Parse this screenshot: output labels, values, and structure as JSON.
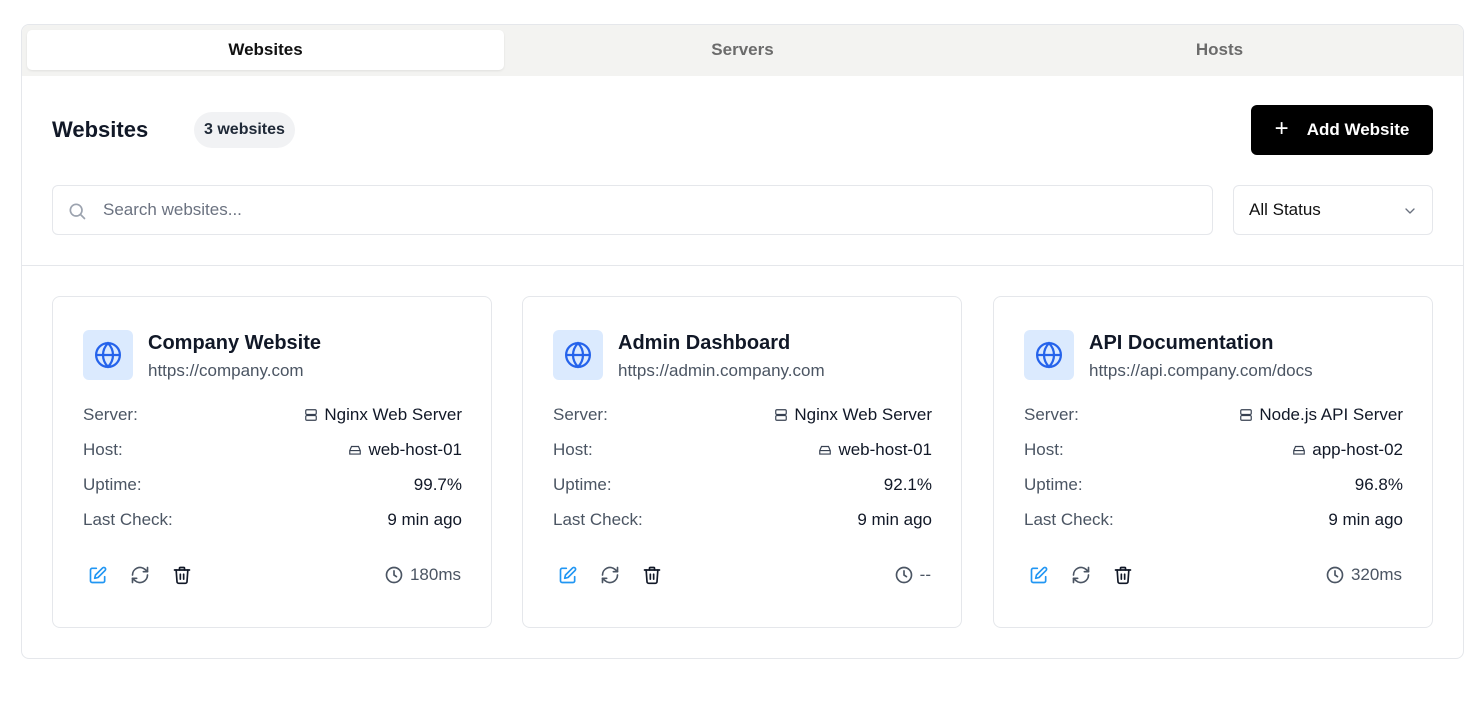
{
  "tabs": [
    {
      "label": "Websites",
      "active": true
    },
    {
      "label": "Servers",
      "active": false
    },
    {
      "label": "Hosts",
      "active": false
    }
  ],
  "header": {
    "title": "Websites",
    "count_badge": "3 websites",
    "add_button_label": "Add Website"
  },
  "search": {
    "placeholder": "Search websites...",
    "value": ""
  },
  "status_filter": {
    "selected": "All Status"
  },
  "labels": {
    "server": "Server:",
    "host": "Host:",
    "uptime": "Uptime:",
    "last_check": "Last Check:"
  },
  "colors": {
    "accent_blue": "#2563eb",
    "icon_bg": "#dbeafe",
    "primary_button": "#000000"
  },
  "websites": [
    {
      "name": "Company Website",
      "url": "https://company.com",
      "server": "Nginx Web Server",
      "host": "web-host-01",
      "uptime": "99.7%",
      "last_check": "9 min ago",
      "response_time": "180ms"
    },
    {
      "name": "Admin Dashboard",
      "url": "https://admin.company.com",
      "server": "Nginx Web Server",
      "host": "web-host-01",
      "uptime": "92.1%",
      "last_check": "9 min ago",
      "response_time": "--"
    },
    {
      "name": "API Documentation",
      "url": "https://api.company.com/docs",
      "server": "Node.js API Server",
      "host": "app-host-02",
      "uptime": "96.8%",
      "last_check": "9 min ago",
      "response_time": "320ms"
    }
  ]
}
